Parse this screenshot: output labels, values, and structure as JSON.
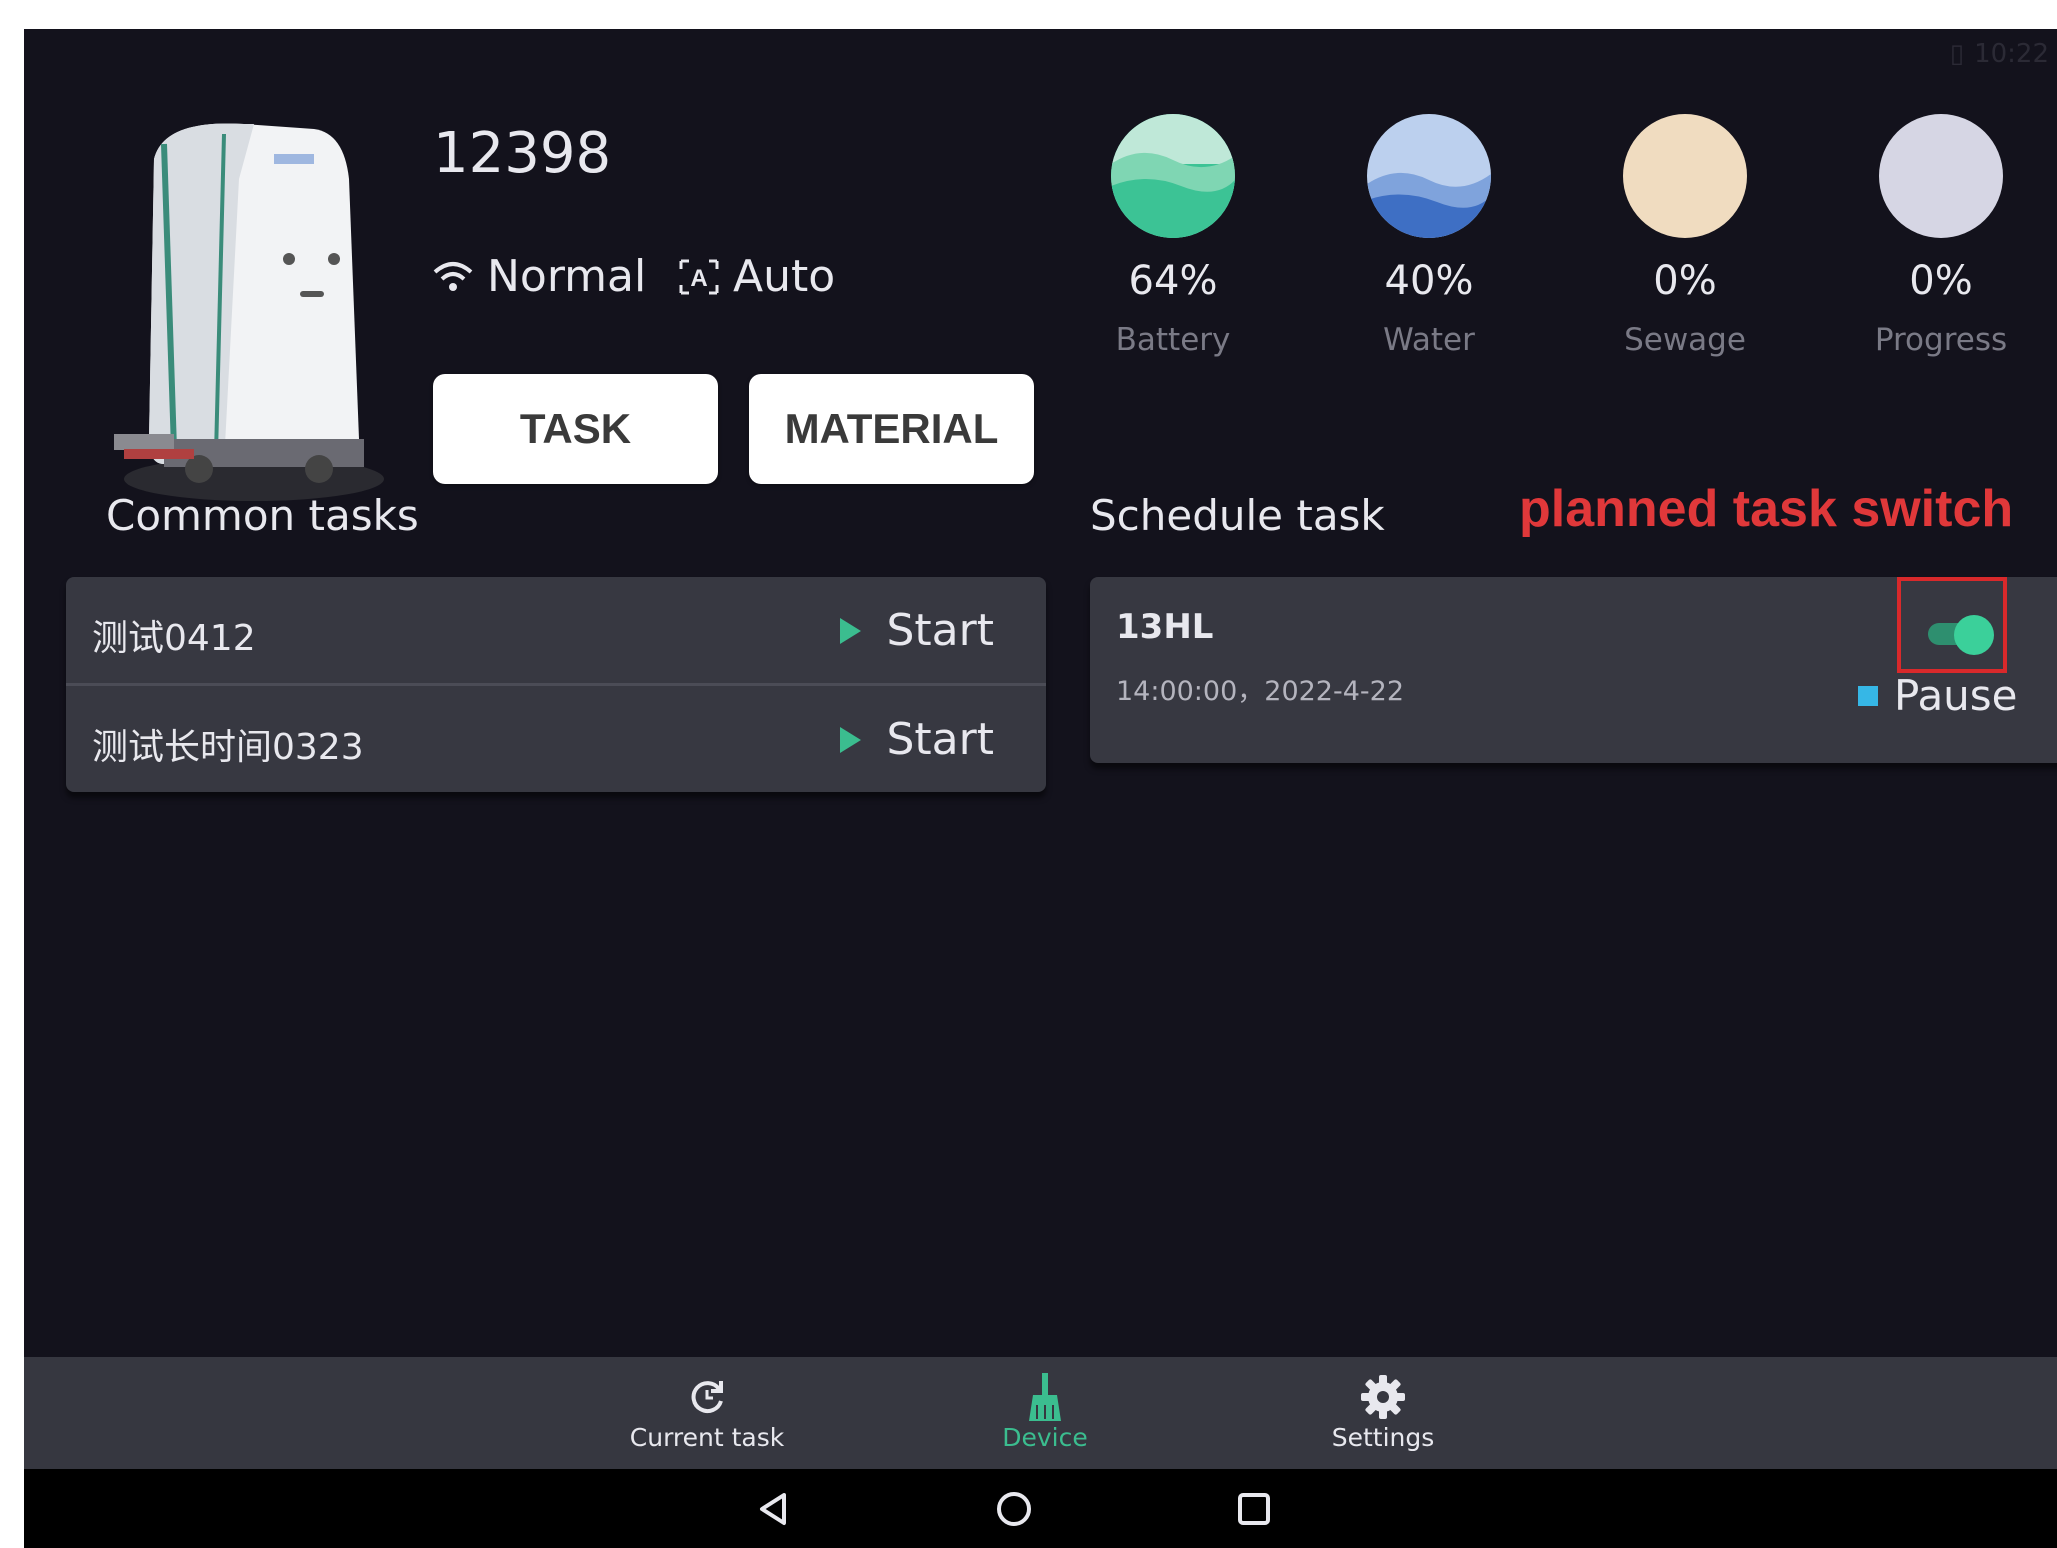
{
  "device": {
    "id": "12398",
    "connection": "Normal",
    "mode": "Auto"
  },
  "buttons": {
    "task": "TASK",
    "material": "MATERIAL"
  },
  "gauges": [
    {
      "value": "64%",
      "label": "Battery",
      "color": "#3cc395"
    },
    {
      "value": "40%",
      "label": "Water",
      "color": "#4a80cf"
    },
    {
      "value": "0%",
      "label": "Sewage",
      "color": "#f0dcc0"
    },
    {
      "value": "0%",
      "label": "Progress",
      "color": "#d6d6e4"
    }
  ],
  "common_tasks": {
    "title": "Common tasks",
    "items": [
      {
        "name": "测试0412",
        "action": "Start"
      },
      {
        "name": "测试长时间0323",
        "action": "Start"
      }
    ]
  },
  "schedule": {
    "title": "Schedule task",
    "annotation": "planned task switch",
    "item": {
      "name": "13HL",
      "time": "14:00:00，2022-4-22",
      "enabled": true,
      "action": "Pause"
    }
  },
  "nav": {
    "items": [
      {
        "label": "Current task",
        "icon": "refresh-icon",
        "active": false
      },
      {
        "label": "Device",
        "icon": "broom-icon",
        "active": true
      },
      {
        "label": "Settings",
        "icon": "gear-icon",
        "active": false
      }
    ],
    "active_color": "#3bbd8f",
    "inactive_color": "#e8e8ee"
  },
  "status_bar": {
    "time": "10:22"
  }
}
